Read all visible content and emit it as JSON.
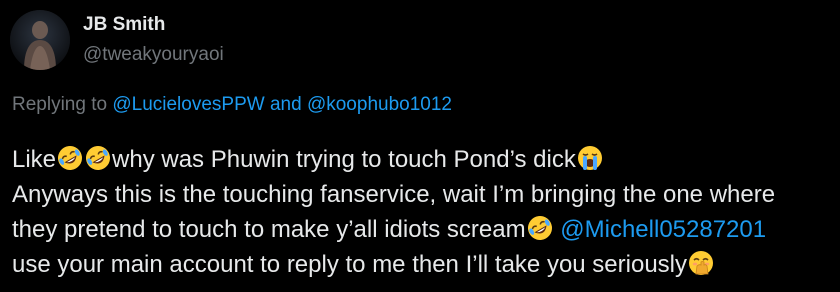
{
  "user": {
    "display_name": "JB Smith",
    "handle": "@tweakyouryaoi"
  },
  "reply_context": {
    "prefix": "Replying to",
    "mention_1": "@LucielovesPPW",
    "joiner": "and",
    "mention_2": "@koophubo1012"
  },
  "tweet": {
    "line_1": {
      "part_1": "Like",
      "emoji_1": "rolling-on-floor-laughing",
      "emoji_2": "rolling-on-floor-laughing",
      "part_2": "why was Phuwin trying to touch Pond’s dick",
      "emoji_3": "loudly-crying-face"
    },
    "line_2": {
      "text": "Anyways this is the touching fanservice, wait I’m bringing the one where"
    },
    "line_3": {
      "part_1": "they pretend to touch to make y’all idiots scream",
      "emoji_1": "rolling-on-floor-laughing",
      "mention": "@Michell05287201"
    },
    "line_4": {
      "text": "use your main account to reply to me then I’ll take you seriously",
      "emoji_1": "face-with-hand-over-mouth"
    }
  },
  "colors": {
    "background": "#000000",
    "text_primary": "#e7e9ea",
    "text_secondary": "#71767b",
    "link": "#1d9bf0",
    "emoji_yellow": "#ffcc33"
  }
}
